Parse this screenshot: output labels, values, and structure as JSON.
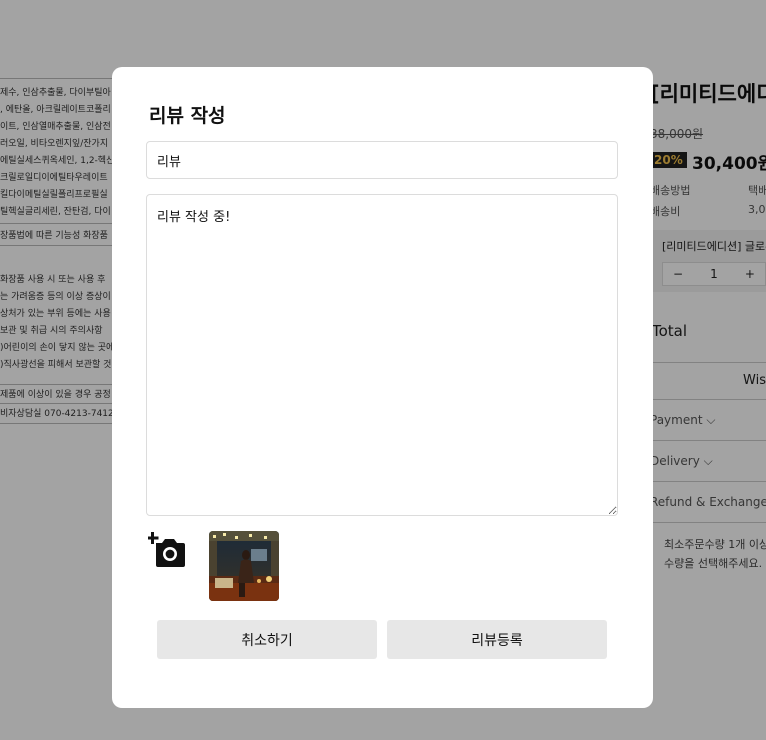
{
  "background": {
    "left_lines": [
      "제수, 인삼추출물, 다이부틸아",
      ", 에탄올, 아크릴레이트코폴리",
      "이트, 인삼열매추출물, 인삼전",
      "러오일, 비타오렌지잎/잔가지",
      "에틸실세스퀴옥세인, 1,2-헥산",
      "크릴로일디이에틸타우레이트",
      "킬다이메틸실릴폴리프로필실",
      "틸헥실글리세린, 잔탄검, 다이"
    ],
    "left_law": "장품법에 따른 기능성 화장품",
    "left_cautions": [
      "화장품 사용 시 또는 사용 후",
      "는 가려움증 등의 이상 증상이",
      "상처가 있는 부위 등에는 사용",
      "보관 및 취급 시의 주의사항",
      ")어린이의 손이 닿지 않는 곳에",
      ")직사광선을 피해서 보관할 것"
    ],
    "left_issue": "제품에 이상이 있을 경우 공정",
    "left_phone": "비자상담실 070-4213-7412",
    "product_title": "[리미티드에디",
    "original_price": "38,000원",
    "discount": "20%",
    "sale_price": "30,400원",
    "shipping_method_label": "배송방법",
    "shipping_method_value": "택배",
    "shipping_fee_label": "배송비",
    "shipping_fee_value": "3,0",
    "option_name": "[리미티드에디션] 글로우",
    "qty_minus": "−",
    "qty_value": "1",
    "qty_plus": "+",
    "total_label": "Total",
    "wish_label": "Wis",
    "accordion": [
      "Payment",
      "Delivery",
      "Refund & Exchange"
    ],
    "chevron": "⌵",
    "note_lines": [
      "최소주문수량 1개 이상",
      "수량을 선택해주세요."
    ]
  },
  "modal": {
    "title": "리뷰 작성",
    "title_input_value": "리뷰",
    "body_textarea_value": "리뷰 작성 중!",
    "cancel_label": "취소하기",
    "submit_label": "리뷰등록",
    "add_photo_icon": "camera-plus-icon",
    "thumbnail_desc_icon": "photo-thumbnail"
  }
}
